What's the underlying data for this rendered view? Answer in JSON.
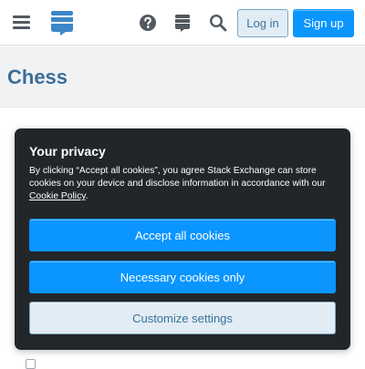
{
  "header": {
    "menu_icon": "hamburger-menu-icon",
    "logo_icon": "stack-exchange-logo",
    "help_icon": "help-question-icon",
    "inbox_icon": "stack-exchange-inbox-icon",
    "search_icon": "search-icon",
    "login_label": "Log in",
    "signup_label": "Sign up"
  },
  "site": {
    "title": "Chess"
  },
  "privacy": {
    "title": "Your privacy",
    "text_before_link": "By clicking “Accept all cookies”, you agree Stack Exchange can store cookies on your device and disclose information in accordance with our ",
    "link_label": "Cookie Policy",
    "text_after_link": ".",
    "accept_label": "Accept all cookies",
    "necessary_label": "Necessary cookies only",
    "customize_label": "Customize settings"
  },
  "colors": {
    "accent_blue": "#0a95ff",
    "site_title": "#3b6e9a",
    "dialog_bg": "#232629",
    "secondary_button_bg": "#e1ecf4"
  }
}
